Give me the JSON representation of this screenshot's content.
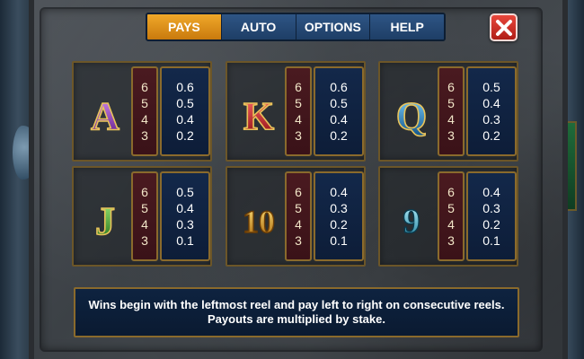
{
  "tabs": [
    {
      "label": "PAYS",
      "active": true
    },
    {
      "label": "AUTO",
      "active": false
    },
    {
      "label": "OPTIONS",
      "active": false
    },
    {
      "label": "HELP",
      "active": false
    }
  ],
  "close_icon": "close-x-icon",
  "colors": {
    "active_tab": "#e0961c",
    "tab": "#24477a",
    "close": "#d3342b",
    "card_border": "#8a6a2c",
    "count_bg": "#451820",
    "value_bg": "#10233f"
  },
  "paytable": [
    {
      "symbol": "A",
      "icon": "letter-a-icon",
      "counts": [
        "6",
        "5",
        "4",
        "3"
      ],
      "values": [
        "0.6",
        "0.5",
        "0.4",
        "0.2"
      ]
    },
    {
      "symbol": "K",
      "icon": "letter-k-icon",
      "counts": [
        "6",
        "5",
        "4",
        "3"
      ],
      "values": [
        "0.6",
        "0.5",
        "0.4",
        "0.2"
      ]
    },
    {
      "symbol": "Q",
      "icon": "letter-q-icon",
      "counts": [
        "6",
        "5",
        "4",
        "3"
      ],
      "values": [
        "0.5",
        "0.4",
        "0.3",
        "0.2"
      ]
    },
    {
      "symbol": "J",
      "icon": "letter-j-icon",
      "counts": [
        "6",
        "5",
        "4",
        "3"
      ],
      "values": [
        "0.5",
        "0.4",
        "0.3",
        "0.1"
      ]
    },
    {
      "symbol": "10",
      "icon": "number-10-icon",
      "counts": [
        "6",
        "5",
        "4",
        "3"
      ],
      "values": [
        "0.4",
        "0.3",
        "0.2",
        "0.1"
      ]
    },
    {
      "symbol": "9",
      "icon": "number-9-icon",
      "counts": [
        "6",
        "5",
        "4",
        "3"
      ],
      "values": [
        "0.4",
        "0.3",
        "0.2",
        "0.1"
      ]
    }
  ],
  "info": {
    "line1": "Wins begin with the leftmost reel and pay left to right on consecutive reels.",
    "line2": "Payouts are multiplied by stake."
  }
}
